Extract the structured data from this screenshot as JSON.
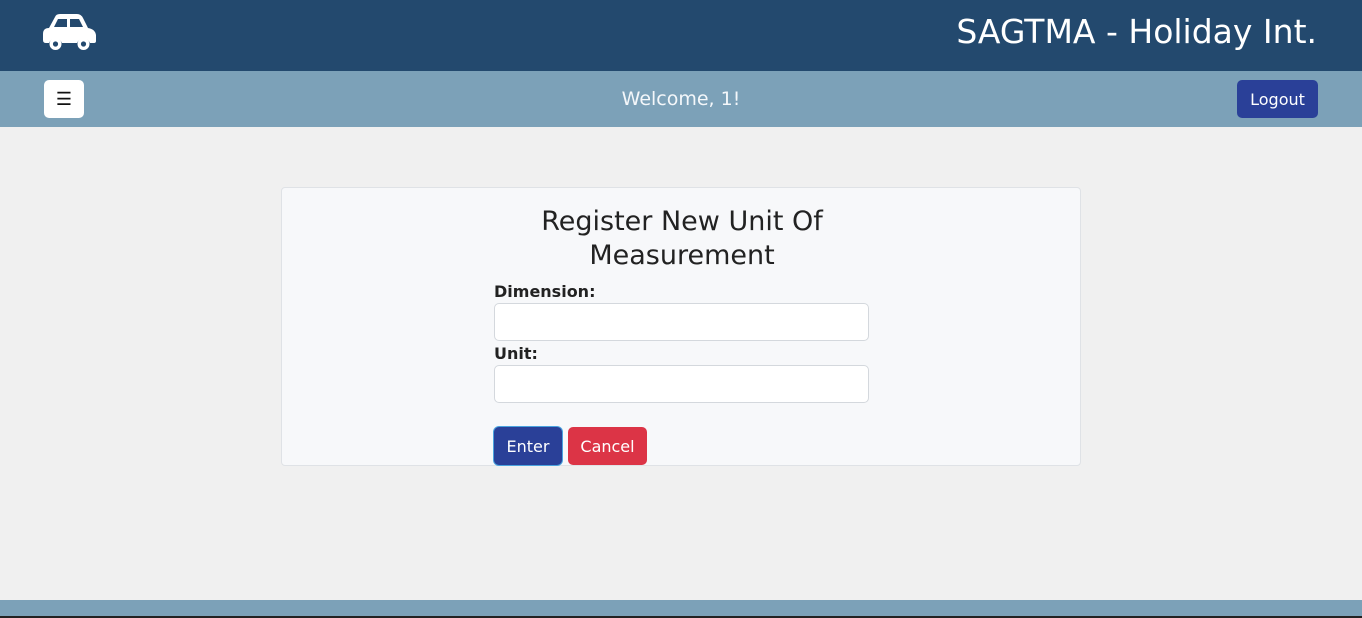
{
  "header": {
    "logo_icon": "car-icon",
    "title": "SAGTMA - Holiday Int.",
    "background": "#23496e"
  },
  "subheader": {
    "menu_icon": "hamburger-icon",
    "menu_glyph": "☰",
    "welcome": "Welcome, 1!",
    "logout_label": "Logout",
    "background": "#7ca1b8"
  },
  "form": {
    "title": "Register New Unit Of Measurement",
    "dimension_label": "Dimension:",
    "dimension_value": "",
    "unit_label": "Unit:",
    "unit_value": "",
    "enter_label": "Enter",
    "cancel_label": "Cancel",
    "enter_color": "#2a4098",
    "cancel_color": "#dc3446"
  }
}
